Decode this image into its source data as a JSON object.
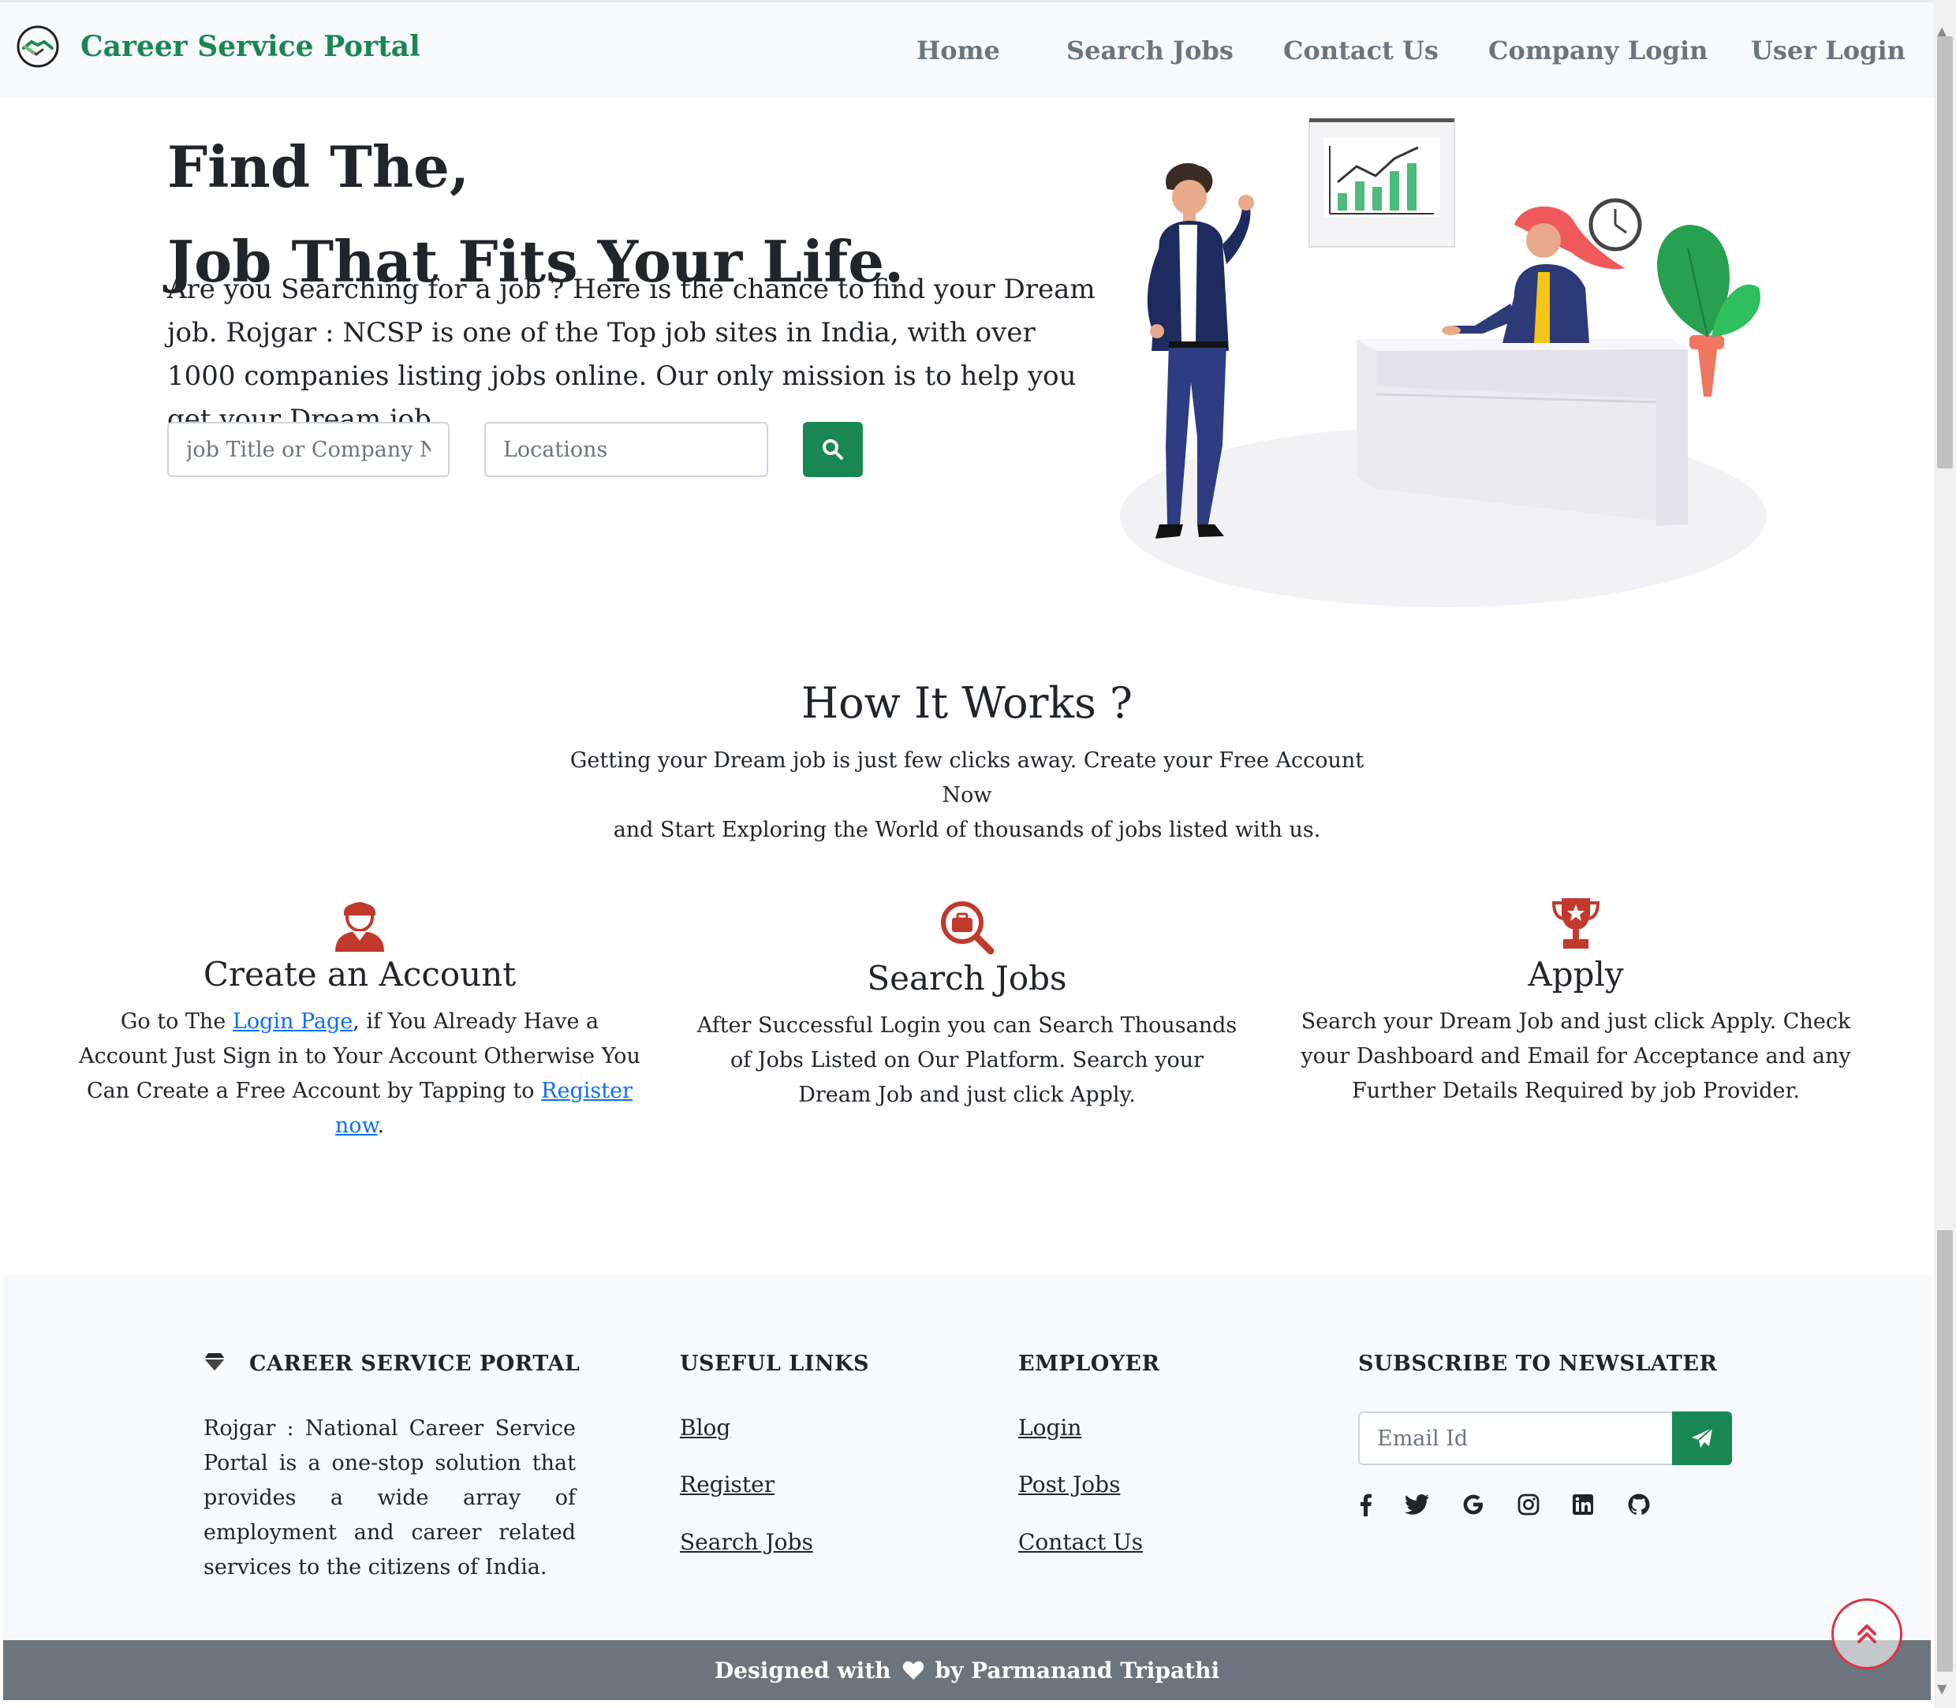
{
  "brand": {
    "name": "Career Service Portal",
    "logo_icon": "handshake-logo-icon"
  },
  "nav": {
    "items": [
      "Home",
      "Search Jobs",
      "Contact Us",
      "Company Login",
      "User Login"
    ]
  },
  "hero": {
    "title_line1": "Find The,",
    "title_line2": "Job That Fits Your Life.",
    "description": "Are you Searching for a job ? Here is the chance to find your Dream job. Rojgar : NCSP is one of the Top job sites in India, with over 1000 companies listing jobs online. Our only mission is to help you get your Dream job.",
    "search_placeholder": "job Title or Company Name",
    "location_placeholder": "Locations",
    "search_button_icon": "search-icon"
  },
  "how": {
    "title": "How It Works ?",
    "subtitle_line1": "Getting your Dream job is just few clicks away. Create your Free Account Now",
    "subtitle_line2": "and Start Exploring the World of thousands of jobs listed with us.",
    "steps": [
      {
        "title": "Create an Account",
        "icon": "user-icon",
        "desc_part1": "Go to The ",
        "link1": "Login Page",
        "desc_part2": ", if You Already Have a Account Just Sign in to Your Account Otherwise You Can Create a Free Account by Tapping to ",
        "link2": "Register now",
        "desc_part3": "."
      },
      {
        "title": "Search Jobs",
        "icon": "job-search-icon",
        "desc": "After Successful Login you can Search Thousands of Jobs Listed on Our Platform. Search your Dream Job and just click Apply."
      },
      {
        "title": "Apply",
        "icon": "trophy-icon",
        "desc": "Search your Dream Job and just click Apply. Check your Dashboard and Email for Acceptance and any Further Details Required by job Provider."
      }
    ]
  },
  "footer": {
    "about_heading": "CAREER SERVICE PORTAL",
    "about_text": "Rojgar : National Career Service Portal is a one-stop solution that provides a wide array of employment and career related services to the citizens of India.",
    "useful_heading": "USEFUL LINKS",
    "useful_links": [
      "Blog",
      "Register",
      "Search Jobs"
    ],
    "employer_heading": "EMPLOYER",
    "employer_links": [
      "Login",
      "Post Jobs",
      "Contact Us"
    ],
    "newsletter_heading": "SUBSCRIBE TO NEWSLATER",
    "email_placeholder": "Email Id",
    "social_icons": [
      "facebook-icon",
      "twitter-icon",
      "google-icon",
      "instagram-icon",
      "linkedin-icon",
      "github-icon"
    ],
    "credit_prefix": "Designed with",
    "credit_suffix": "by Parmanand Tripathi"
  },
  "colors": {
    "brand_green": "#198754",
    "accent_red": "#c0392b",
    "footer_bar": "#6c757d",
    "link_blue": "#0d6efd"
  }
}
